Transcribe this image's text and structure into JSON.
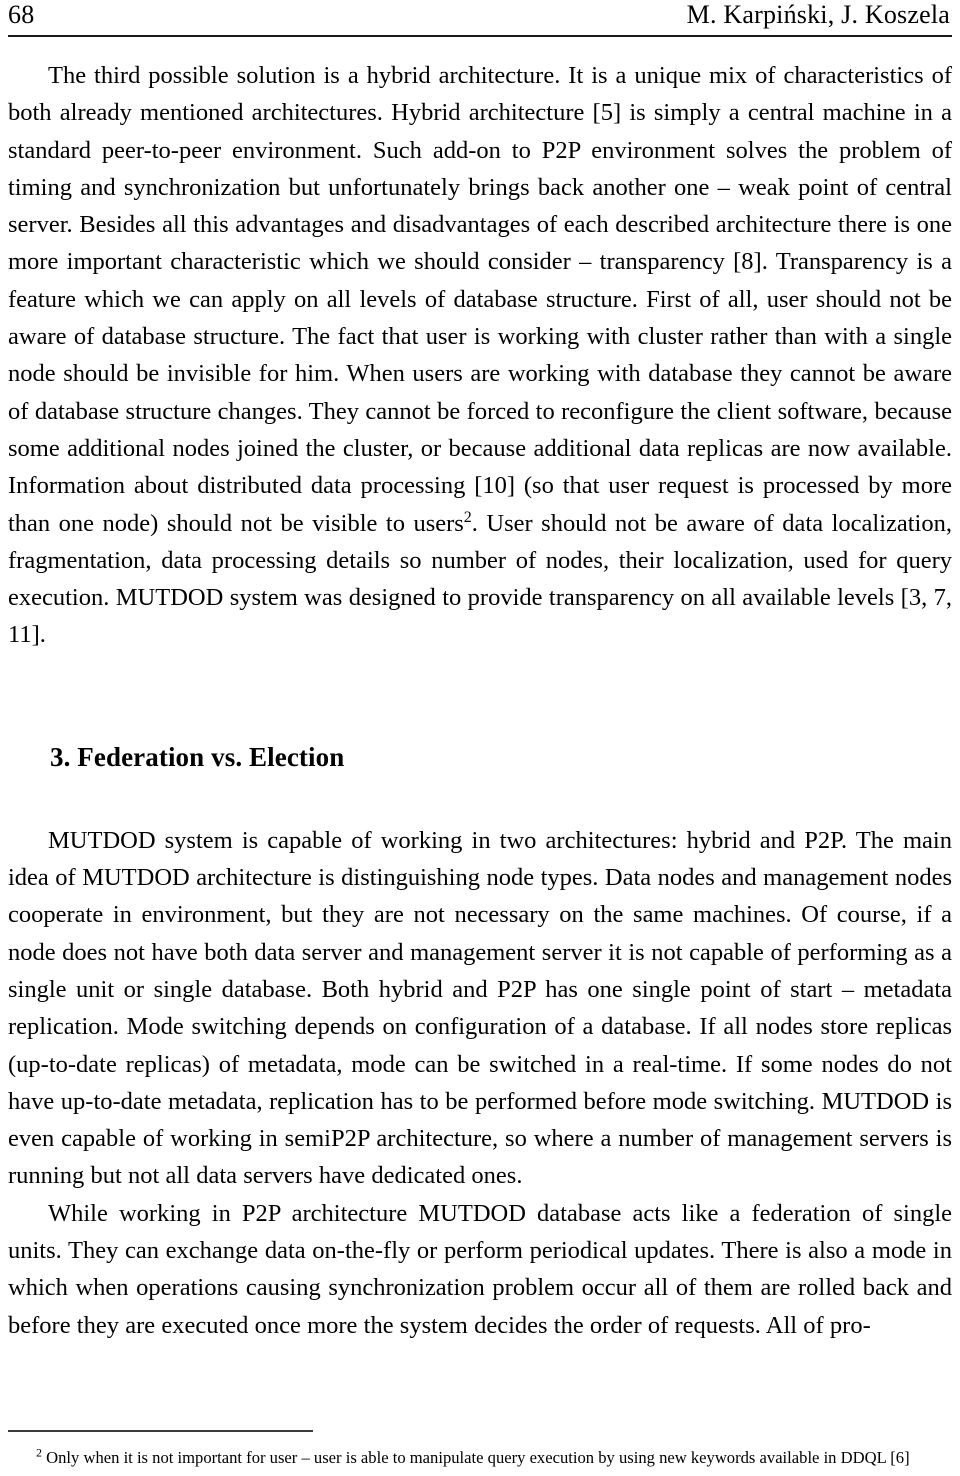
{
  "header": {
    "folio": "68",
    "authors": "M. Karpiński, J. Koszela"
  },
  "body": {
    "paragraph_1": "The third possible solution is a hybrid architecture. It is a unique mix of characteristics of both already mentioned architectures. Hybrid architecture [5] is simply a central machine in a standard peer-to-peer environment. Such add-on to P2P environment solves the problem of timing and synchronization but unfortunately brings back another one – weak point of central server. Besides all this advantages and disadvantages of each described architecture there is one more important characteristic which we should consider – transparency [8]. Transparency is a feature which we can apply on all levels of database structure. First of all, user should not be aware of database structure. The fact that user is working with cluster rather than with a single node should be invisible for him. When users are working with database they cannot be aware of database structure changes. They cannot be forced to reconfigure the client software, because some additional nodes joined the cluster, or because additional data replicas are now available. Information about distributed data processing [10] (so that user request is processed by more than one node) should not be visible to users",
    "footnote_marker_1": "2",
    "paragraph_1_tail": ". User should not be aware of data localization, fragmentation, data processing details so number of nodes, their localization, used for query execution. MUTDOD system was designed to provide transparency on all available levels [3, 7, 11].",
    "section_heading": "3. Federation vs. Election",
    "paragraph_2": "MUTDOD system is capable of working in two architectures: hybrid and P2P. The main idea of MUTDOD architecture is distinguishing node types. Data nodes and management nodes cooperate in environment, but they are not necessary on the same machines. Of course, if a node does not have both data server and management server it is not capable of performing as a single unit or single database. Both hybrid and P2P has one single point of start – metadata replication. Mode switching depends on configuration of a database. If all nodes store replicas (up-to-date replicas) of metadata, mode can be switched in a real-time. If some nodes do not have up-to-date metadata, replication has to be performed before mode switching. MUTDOD is even capable of working in semiP2P architecture, so where a number of management servers is running but not all data servers have dedicated ones.",
    "paragraph_3": "While working in P2P architecture MUTDOD database acts like a federation of single units. They can exchange data on-the-fly or perform periodical updates. There is also a mode in which when operations causing synchronization problem occur all of them are rolled back and before they are executed once more the system decides the order of requests. All of pro-"
  },
  "footnote": {
    "marker": "2",
    "text": " Only when it is not important for user – user is able to manipulate query execution by using new keywords available in DDQL [6]"
  },
  "colors": {
    "text": "#000000",
    "rule": "#1a1a1a",
    "footnote_rule": "#3a3a3a",
    "page_background": "#ffffff"
  }
}
